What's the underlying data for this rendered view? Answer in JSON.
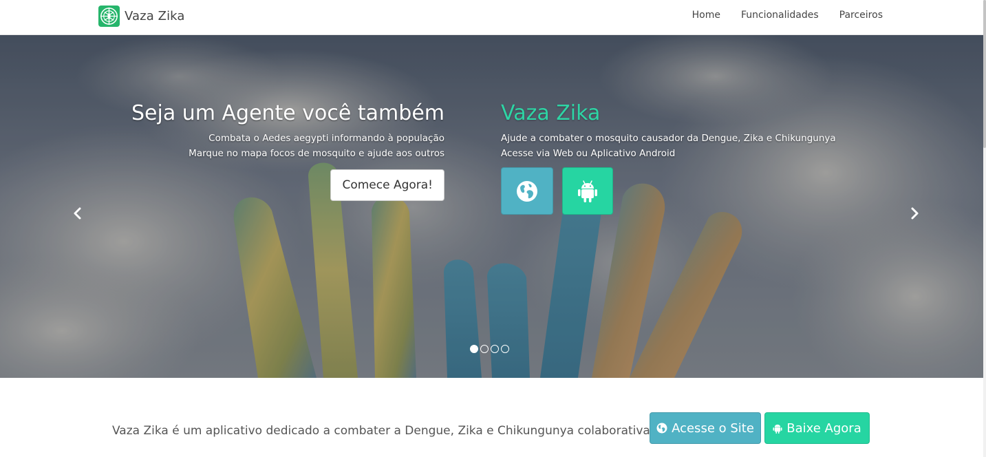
{
  "navbar": {
    "brand": "Vaza Zika",
    "links": [
      "Home",
      "Funcionalidades",
      "Parceiros"
    ]
  },
  "hero": {
    "left": {
      "title": "Seja um Agente você também",
      "line1": "Combata o Aedes aegypti informando à população",
      "line2": "Marque no mapa focos de mosquito e ajude aos outros",
      "cta": "Comece Agora!"
    },
    "right": {
      "title": "Vaza Zika",
      "line1": "Ajude a combater o mosquito causador da Dengue, Zika e Chikungunya",
      "line2": "Acesse via Web ou Aplicativo Android"
    },
    "slide_count": 4,
    "active_slide": 1
  },
  "promo": {
    "text": "Vaza Zika é um aplicativo dedicado a combater a Dengue, Zika e Chikungunya colaborativamente",
    "site_button": "Acesse o Site",
    "download_button": "Baixe Agora"
  },
  "colors": {
    "accent_green": "#26d5a2",
    "accent_blue": "#50b2c4",
    "title_green": "#2ed5a5"
  },
  "icons": [
    "vaza-zika-logo-icon",
    "globe-icon",
    "android-icon",
    "chevron-left-icon",
    "chevron-right-icon"
  ]
}
